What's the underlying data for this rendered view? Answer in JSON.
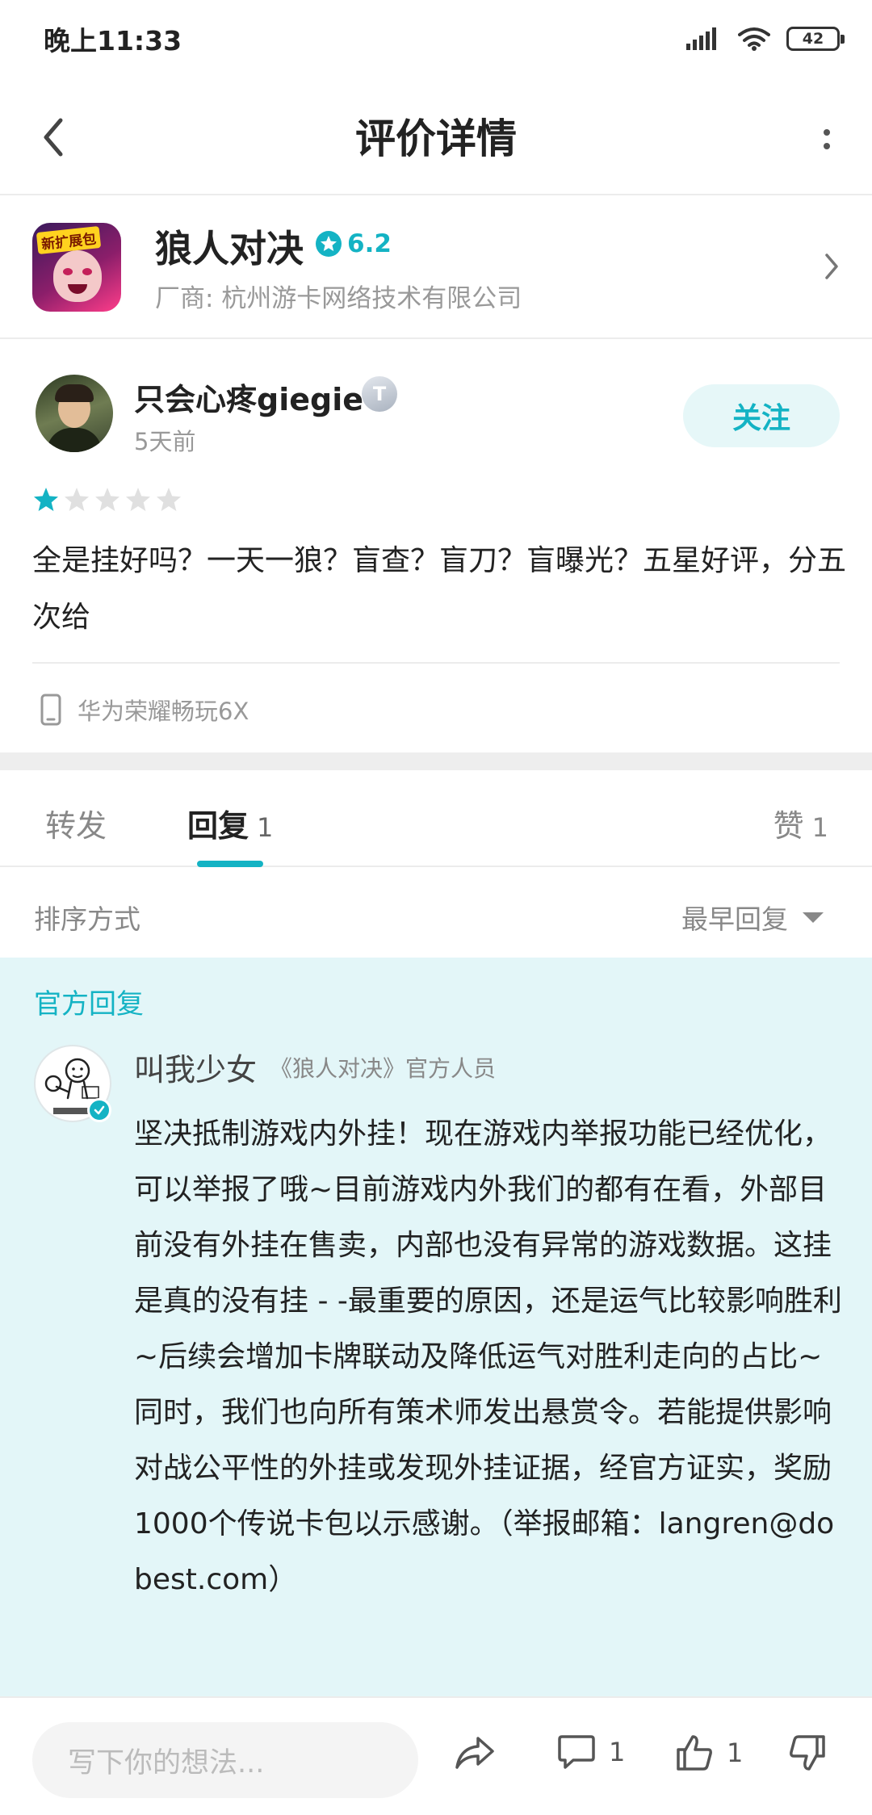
{
  "status_bar": {
    "time": "晚上11:33",
    "battery": "42"
  },
  "nav": {
    "title": "评价详情"
  },
  "app": {
    "name": "狼人对决",
    "rating": "6.2",
    "vendor": "厂商: 杭州游卡网络技术有限公司",
    "icon_tag": "新扩展包"
  },
  "review": {
    "username": "只会心疼giegie",
    "level_badge": "T",
    "time": "5天前",
    "follow_label": "关注",
    "stars": 1,
    "stars_max": 5,
    "text": "全是挂好吗？一天一狼？盲查？盲刀？盲曝光？五星好评，分五次给",
    "device": "华为荣耀畅玩6X"
  },
  "tabs": {
    "forward": "转发",
    "reply": "回复",
    "reply_count": "1",
    "like": "赞",
    "like_count": "1"
  },
  "sort": {
    "label": "排序方式",
    "value": "最早回复"
  },
  "official_reply": {
    "section_label": "官方回复",
    "name": "叫我少女",
    "role": "《狼人对决》官方人员",
    "text": "坚决抵制游戏内外挂！现在游戏内举报功能已经优化，可以举报了哦~目前游戏内外我们的都有在看，外部目前没有外挂在售卖，内部也没有异常的游戏数据。这挂是真的没有挂 - -最重要的原因，还是运气比较影响胜利~后续会增加卡牌联动及降低运气对胜利走向的占比~ 同时，我们也向所有策术师发出悬赏令。若能提供影响对战公平性的外挂或发现外挂证据，经官方证实，奖励1000个传说卡包以示感谢。（举报邮箱：langren@dobest.com）"
  },
  "bottom": {
    "input_placeholder": "写下你的想法...",
    "comment_count": "1",
    "like_count": "1"
  },
  "colors": {
    "accent": "#14b3c4",
    "official_bg": "#e3f6f8",
    "star_empty": "#e0e0e0"
  }
}
